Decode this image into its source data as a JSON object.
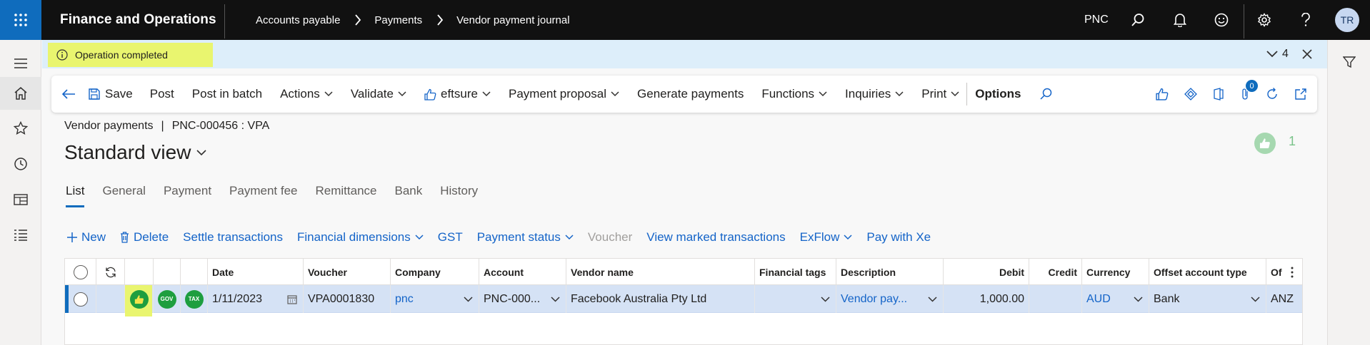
{
  "app": {
    "title": "Finance and Operations",
    "company": "PNC",
    "user_initials": "TR"
  },
  "breadcrumb": [
    "Accounts payable",
    "Payments",
    "Vendor payment journal"
  ],
  "message": {
    "text": "Operation completed",
    "count": "4",
    "highlight_color": "#e9f56f"
  },
  "action_pane": {
    "save": "Save",
    "post": "Post",
    "post_in_batch": "Post in batch",
    "actions": "Actions",
    "validate": "Validate",
    "eftsure": "eftsure",
    "payment_proposal": "Payment proposal",
    "generate_payments": "Generate payments",
    "functions": "Functions",
    "inquiries": "Inquiries",
    "print": "Print",
    "options": "Options",
    "attachment_count": "0"
  },
  "page": {
    "caption": "Vendor payments",
    "record": "PNC-000456 : VPA",
    "view": "Standard view",
    "likes": "1"
  },
  "tabs": [
    "List",
    "General",
    "Payment",
    "Payment fee",
    "Remittance",
    "Bank",
    "History"
  ],
  "grid_toolbar": {
    "new": "New",
    "delete": "Delete",
    "settle": "Settle transactions",
    "financial_dimensions": "Financial dimensions",
    "gst": "GST",
    "payment_status": "Payment status",
    "voucher": "Voucher",
    "view_marked": "View marked transactions",
    "exflow": "ExFlow",
    "pay_with_xe": "Pay with Xe"
  },
  "grid": {
    "columns": {
      "date": "Date",
      "voucher": "Voucher",
      "company": "Company",
      "account": "Account",
      "vendor_name": "Vendor name",
      "financial_tags": "Financial tags",
      "description": "Description",
      "debit": "Debit",
      "credit": "Credit",
      "currency": "Currency",
      "offset_account_type": "Offset account type",
      "offset": "Of"
    },
    "row": {
      "gov": "GOV",
      "tax": "TAX",
      "date": "1/11/2023",
      "voucher": "VPA0001830",
      "company": "pnc",
      "account": "PNC-000...",
      "vendor_name": "Facebook Australia Pty Ltd",
      "financial_tags": "",
      "description": "Vendor pay...",
      "debit": "1,000.00",
      "credit": "",
      "currency": "AUD",
      "offset_account_type": "Bank",
      "offset": "ANZ"
    }
  },
  "colors": {
    "brand": "#0f6cbd",
    "link": "#1464c8",
    "selected_row": "#d5e2f5",
    "ok_badge": "#1e9e3f"
  }
}
